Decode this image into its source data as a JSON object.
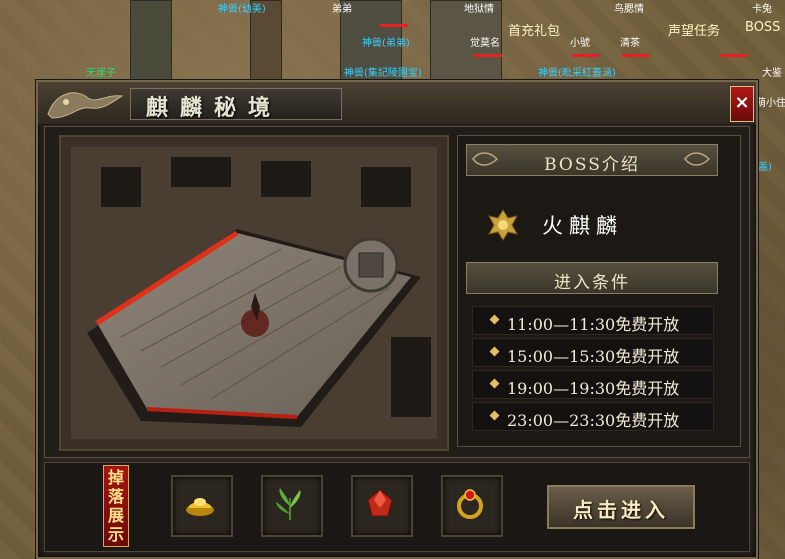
{
  "world": {
    "labels": [
      {
        "text": "神兽(幼美)",
        "color": "blue"
      },
      {
        "text": "弟弟",
        "color": "white"
      },
      {
        "text": "地狱情",
        "color": "white"
      },
      {
        "text": "鸟腮情",
        "color": "white"
      },
      {
        "text": "卡兔",
        "color": "white"
      },
      {
        "text": "无崖子",
        "color": "green"
      },
      {
        "text": "神兽(弟弟)",
        "color": "blue"
      },
      {
        "text": "觉莫名",
        "color": "white"
      },
      {
        "text": "小號",
        "color": "white"
      },
      {
        "text": "清茶",
        "color": "white"
      },
      {
        "text": "神兽(集記陵園宝)",
        "color": "blue"
      },
      {
        "text": "神兽(毗采紅蓋涵)",
        "color": "blue"
      },
      {
        "text": "大鉴",
        "color": "white"
      },
      {
        "text": "萌小住",
        "color": "white"
      },
      {
        "text": "盖)",
        "color": "blue"
      }
    ],
    "top_buttons": [
      "首充礼包",
      "声望任务",
      "BOSS"
    ]
  },
  "panel": {
    "title": "麒麟秘境",
    "close_label": "×",
    "boss_header": "BOSS介绍",
    "boss_name": "火麒麟",
    "conditions_header": "进入条件",
    "schedule": [
      "11:00—11:30免费开放",
      "15:00—15:30免费开放",
      "19:00—19:30免费开放",
      "23:00—23:30免费开放"
    ],
    "drops_label": "掉落展示",
    "drops": [
      {
        "icon": "gold-ingot-icon"
      },
      {
        "icon": "herb-icon"
      },
      {
        "icon": "red-gem-icon"
      },
      {
        "icon": "dragon-ring-icon"
      }
    ],
    "enter_label": "点击进入"
  },
  "colors": {
    "panel_bg": "#2a2520",
    "accent_red": "#a51410",
    "gold": "#e0c060"
  }
}
